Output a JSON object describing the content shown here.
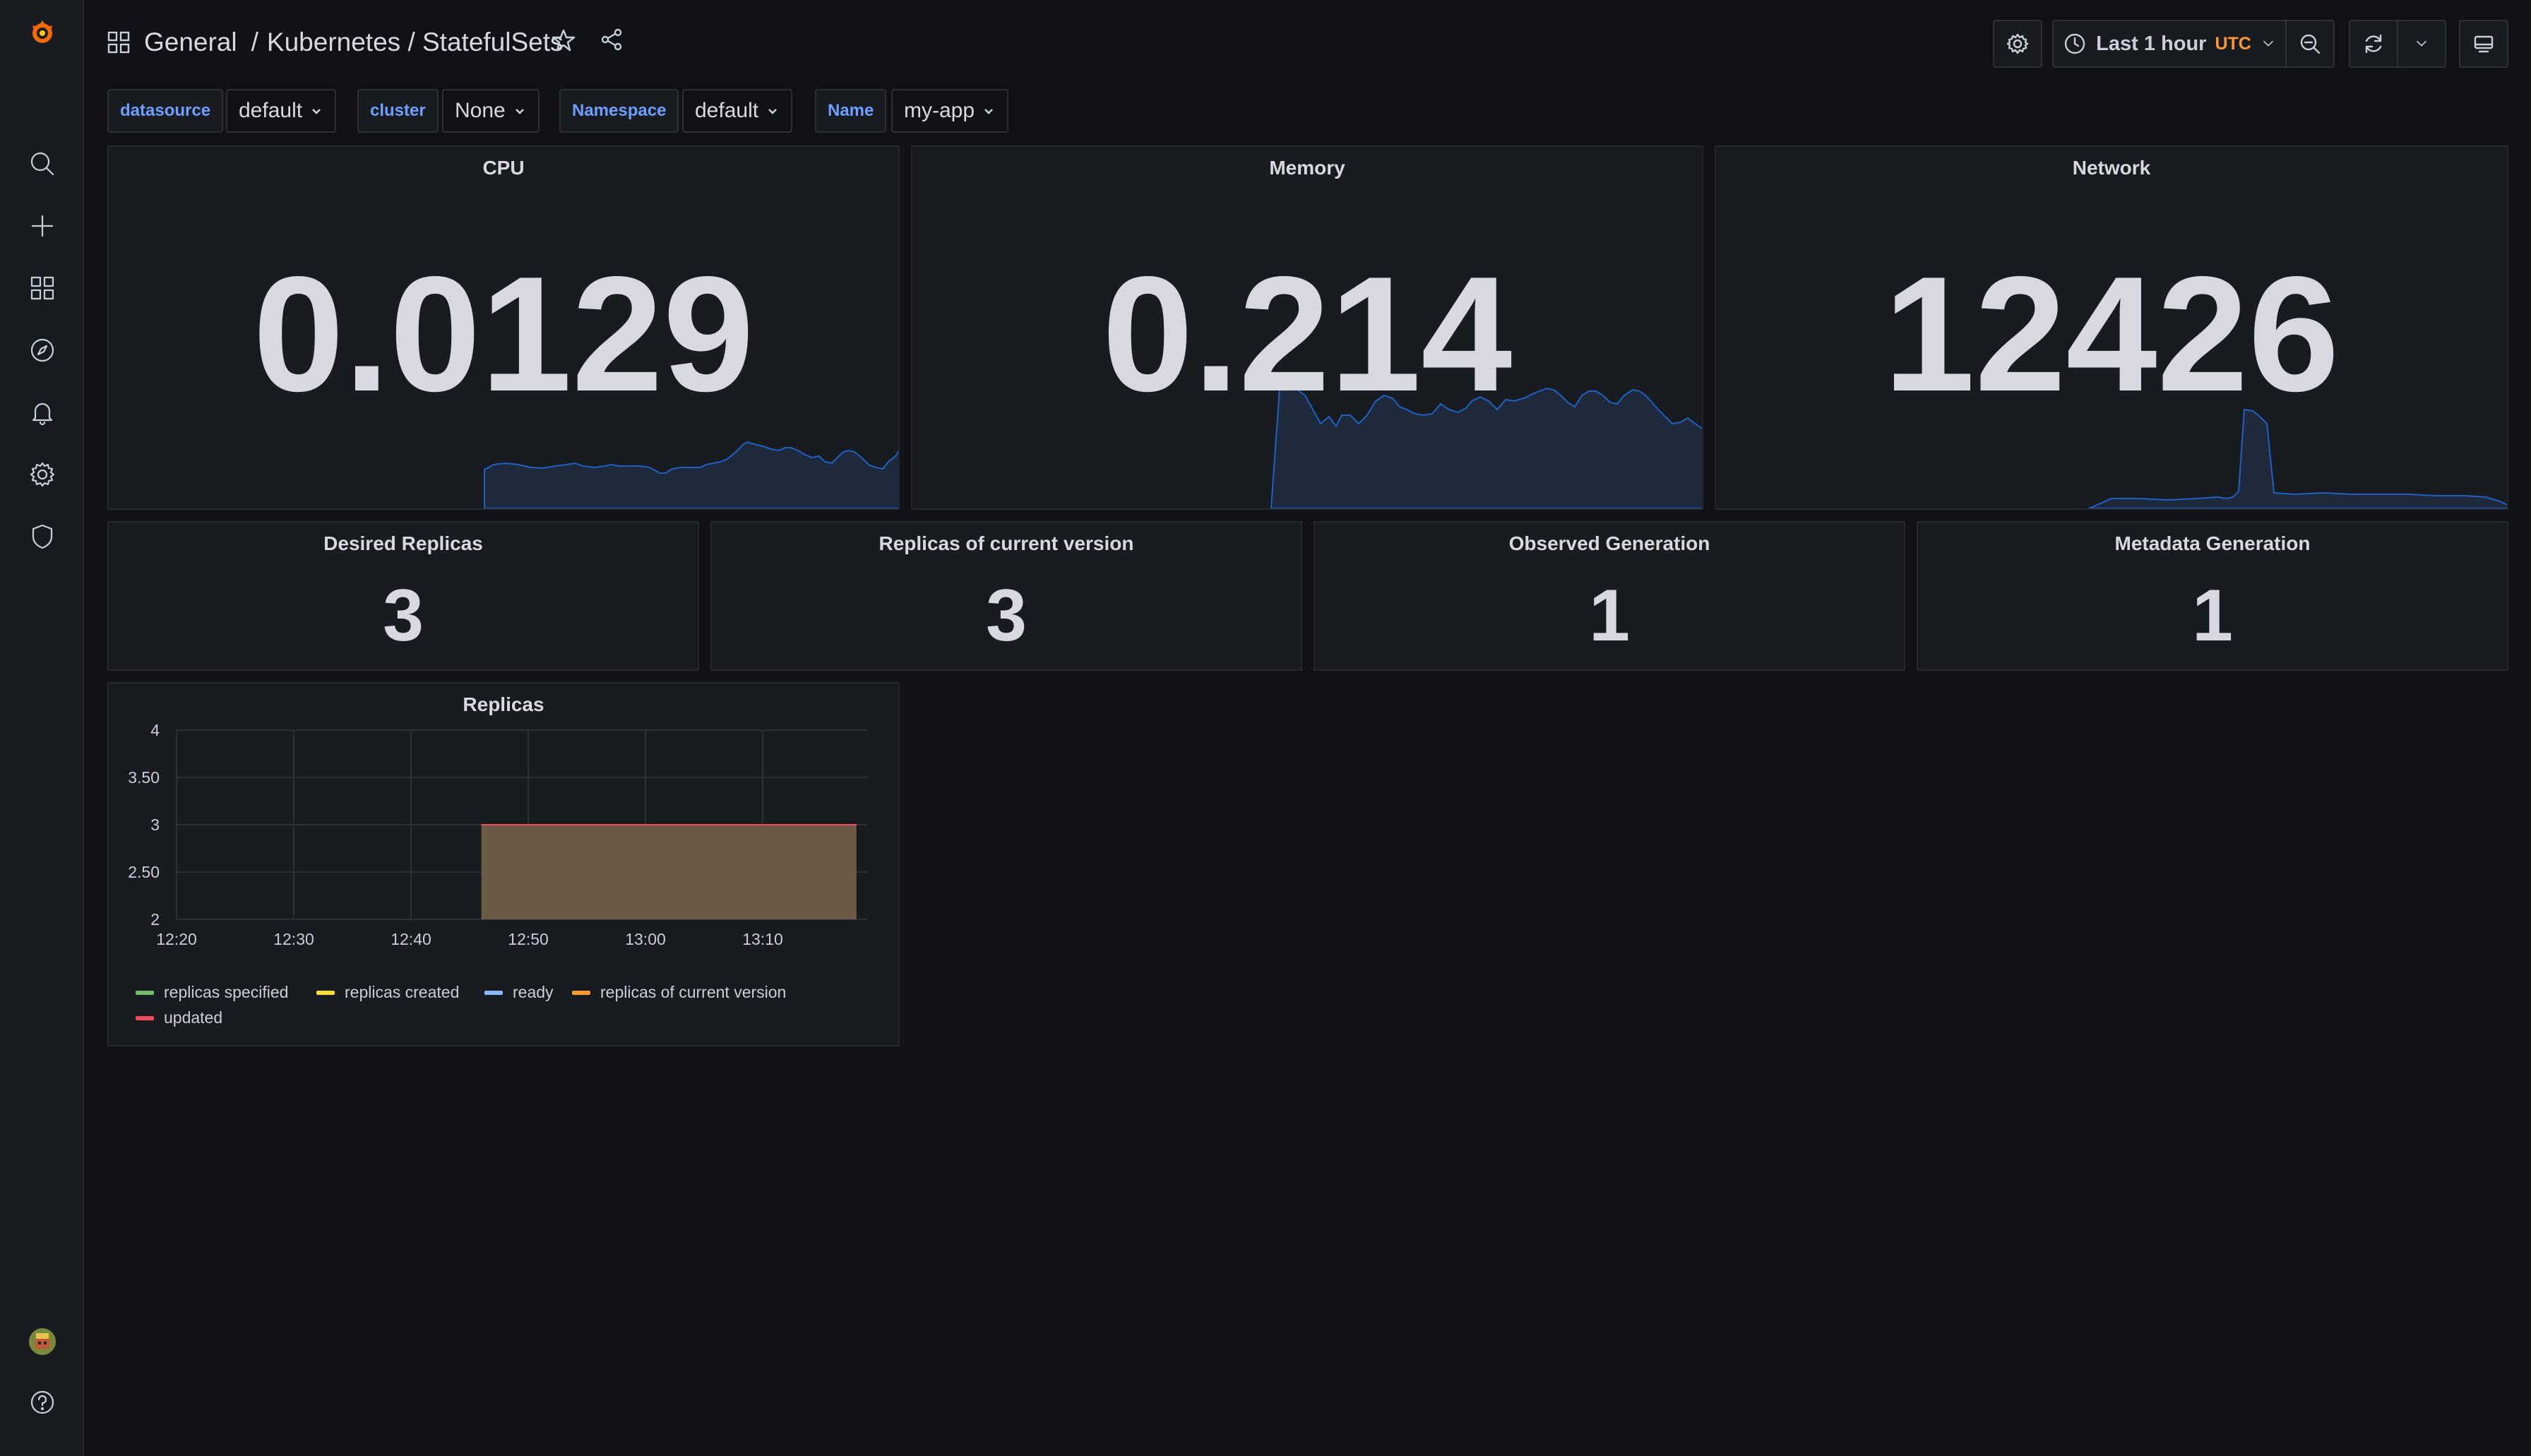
{
  "breadcrumb": {
    "folder": "General",
    "separator": "/",
    "title": "Kubernetes / StatefulSets"
  },
  "timepicker": {
    "range": "Last 1 hour",
    "timezone": "UTC"
  },
  "variables": [
    {
      "label": "datasource",
      "value": "default"
    },
    {
      "label": "cluster",
      "value": "None"
    },
    {
      "label": "Namespace",
      "value": "default"
    },
    {
      "label": "Name",
      "value": "my-app"
    }
  ],
  "stats_top": [
    {
      "title": "CPU",
      "value": "0.0129"
    },
    {
      "title": "Memory",
      "value": "0.214"
    },
    {
      "title": "Network",
      "value": "12426"
    }
  ],
  "stats_small": [
    {
      "title": "Desired Replicas",
      "value": "3"
    },
    {
      "title": "Replicas of current version",
      "value": "3"
    },
    {
      "title": "Observed Generation",
      "value": "1"
    },
    {
      "title": "Metadata Generation",
      "value": "1"
    }
  ],
  "colors": {
    "background": "#111217",
    "panel": "#181b1f",
    "spark": "#1f60c4",
    "fill": "#6b5a45",
    "line": "#e02f44",
    "accent": "#ff9830",
    "link": "#6e9fff"
  },
  "chart_data": {
    "type": "area",
    "title": "Replicas",
    "x": [
      "12:20",
      "12:30",
      "12:40",
      "12:50",
      "13:00",
      "13:10"
    ],
    "y_ticks": [
      "4",
      "3.50",
      "3",
      "2.50",
      "2"
    ],
    "ylim": [
      2,
      4
    ],
    "series": [
      {
        "name": "replicas specified",
        "color": "#73bf69",
        "points": [
          [
            "12:46",
            3
          ],
          [
            "13:18",
            3
          ]
        ]
      },
      {
        "name": "replicas created",
        "color": "#fade2a",
        "points": [
          [
            "12:46",
            3
          ],
          [
            "13:18",
            3
          ]
        ]
      },
      {
        "name": "ready",
        "color": "#8ab8ff",
        "points": [
          [
            "12:46",
            3
          ],
          [
            "13:18",
            3
          ]
        ]
      },
      {
        "name": "replicas of current version",
        "color": "#ff9830",
        "points": [
          [
            "12:46",
            3
          ],
          [
            "13:18",
            3
          ]
        ]
      },
      {
        "name": "updated",
        "color": "#f2495c",
        "points": [
          [
            "12:46",
            3
          ],
          [
            "13:18",
            3
          ]
        ]
      }
    ],
    "grid": true,
    "legend": "bottom"
  }
}
